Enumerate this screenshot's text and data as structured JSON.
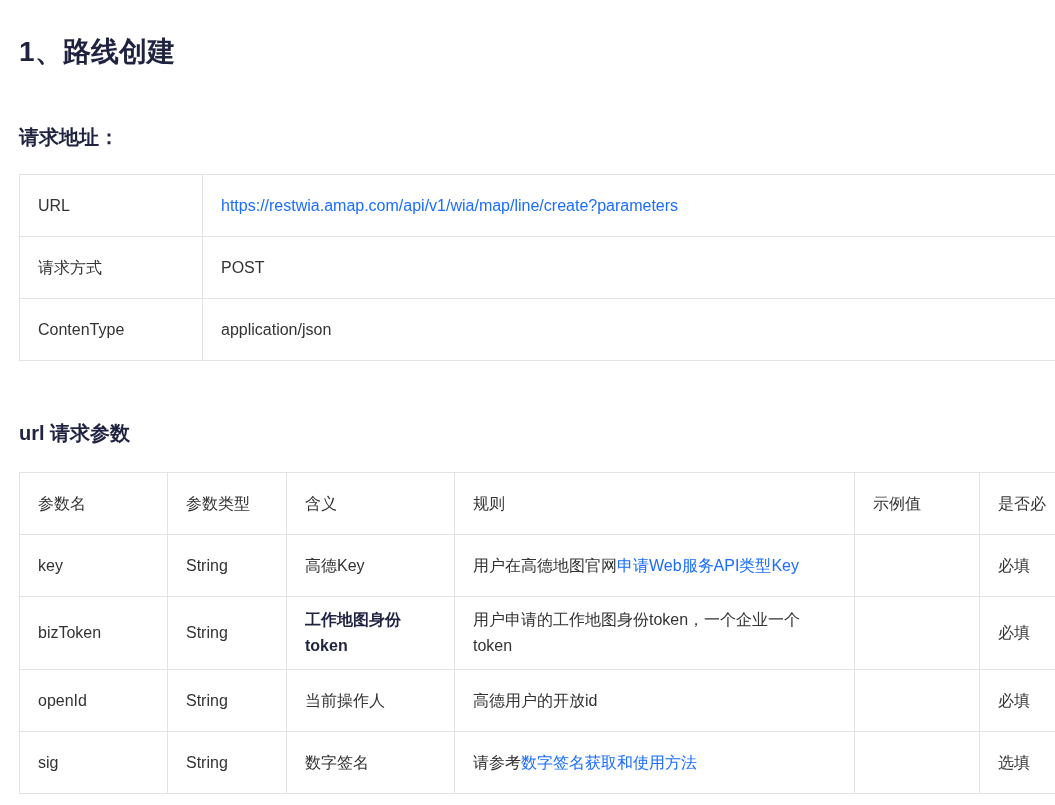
{
  "title": "1、路线创建",
  "request_section": {
    "heading": "请求地址：",
    "rows": [
      {
        "label": "URL",
        "value": "https://restwia.amap.com/api/v1/wia/map/line/create?parameters",
        "link": true
      },
      {
        "label": "请求方式",
        "value": "POST",
        "link": false
      },
      {
        "label": "ContenType",
        "value": "application/json",
        "link": false
      }
    ]
  },
  "params_section": {
    "heading": "url 请求参数",
    "columns": [
      "参数名",
      "参数类型",
      "含义",
      "规则",
      "示例值",
      "是否必"
    ],
    "rows": [
      {
        "name": "key",
        "type": "String",
        "meaning": "高德Key",
        "meaning_bold": false,
        "rule": [
          {
            "text": "用户在高德地图官网",
            "link": false
          },
          {
            "text": "申请Web服务API类型Key",
            "link": true
          }
        ],
        "required": "必填"
      },
      {
        "name": "bizToken",
        "type": "String",
        "meaning": "工作地图身份token",
        "meaning_bold": true,
        "rule": [
          {
            "text": "用户申请的工作地图身份token，一个企业一个token",
            "link": false
          }
        ],
        "required": "必填"
      },
      {
        "name": "openId",
        "type": "String",
        "meaning": "当前操作人",
        "meaning_bold": false,
        "rule": [
          {
            "text": "高德用户的开放id",
            "link": false
          }
        ],
        "required": "必填"
      },
      {
        "name": "sig",
        "type": "String",
        "meaning": "数字签名",
        "meaning_bold": false,
        "rule": [
          {
            "text": "请参考",
            "link": false
          },
          {
            "text": "数字签名获取和使用方法",
            "link": true
          }
        ],
        "required": "选填"
      }
    ]
  }
}
